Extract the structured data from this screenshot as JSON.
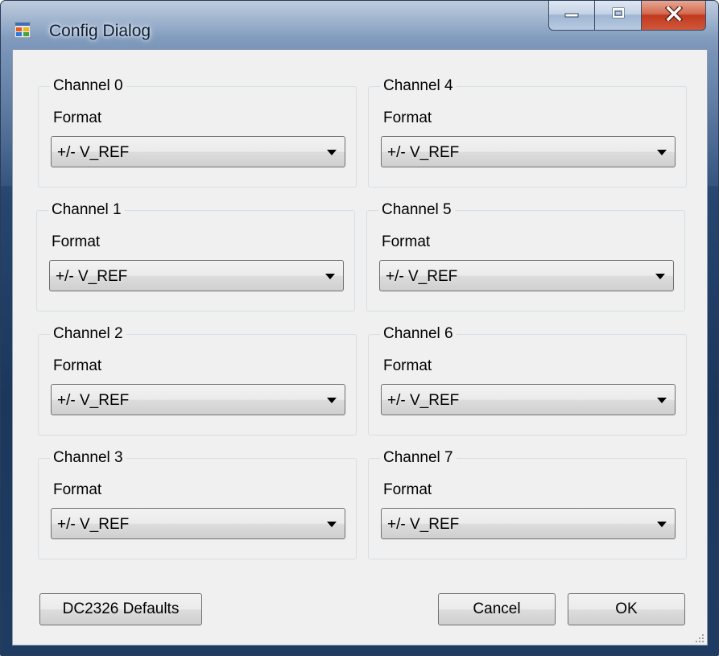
{
  "window": {
    "title": "Config Dialog",
    "app_icon": "window-app-icon",
    "caption_buttons": [
      {
        "name": "minimize",
        "icon": "minimize-icon"
      },
      {
        "name": "maximize",
        "icon": "maximize-icon"
      },
      {
        "name": "close",
        "icon": "close-icon"
      }
    ]
  },
  "channels": [
    {
      "title": "Channel 0",
      "format_label": "Format",
      "format_value": "+/- V_REF"
    },
    {
      "title": "Channel 1",
      "format_label": "Format",
      "format_value": "+/- V_REF"
    },
    {
      "title": "Channel 2",
      "format_label": "Format",
      "format_value": "+/- V_REF"
    },
    {
      "title": "Channel 3",
      "format_label": "Format",
      "format_value": "+/- V_REF"
    },
    {
      "title": "Channel 4",
      "format_label": "Format",
      "format_value": "+/- V_REF"
    },
    {
      "title": "Channel 5",
      "format_label": "Format",
      "format_value": "+/- V_REF"
    },
    {
      "title": "Channel 6",
      "format_label": "Format",
      "format_value": "+/- V_REF"
    },
    {
      "title": "Channel 7",
      "format_label": "Format",
      "format_value": "+/- V_REF"
    }
  ],
  "buttons": {
    "defaults": "DC2326 Defaults",
    "cancel": "Cancel",
    "ok": "OK"
  },
  "colors": {
    "close_button": "#c1391f",
    "dialog_background": "#f0f0f0",
    "title_bar": "#1b375c"
  }
}
